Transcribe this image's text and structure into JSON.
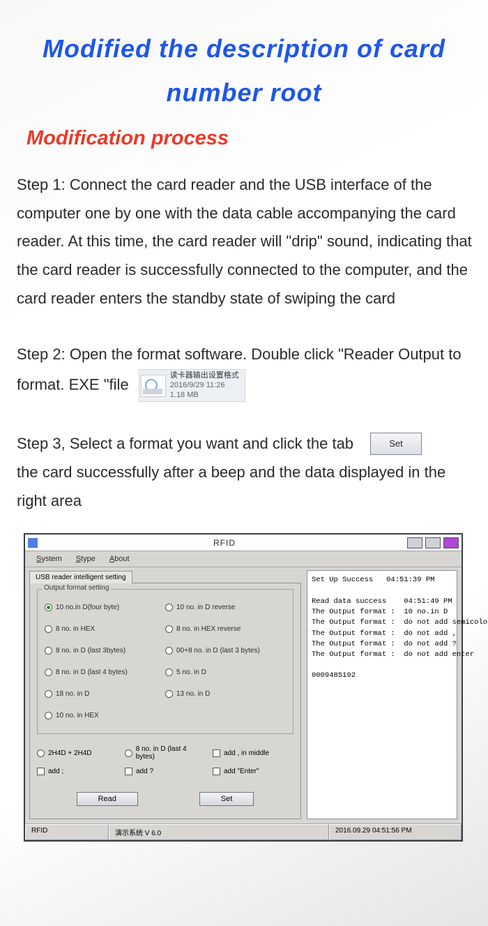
{
  "title": "Modified the description of card number root",
  "subtitle": "Modification process",
  "steps": {
    "s1": "Step 1: Connect the card reader and the USB interface of the computer one by one with the data cable accompanying the card reader. At this time, the card reader will \"drip\" sound, indicating that the card reader is successfully connected to the computer, and the card reader enters the standby state of swiping the card",
    "s2a": "Step 2: Open the format software. Double click \"Reader Output to format. EXE \"file",
    "file": {
      "name": "读卡器输出设置格式",
      "date": "2016/9/29 11:26",
      "size": "1.18 MB"
    },
    "s3a": "Step 3, Select a format you want and click the tab",
    "s3btn": "Set",
    "s3b": "the card successfully after a beep and the data displayed in the right area"
  },
  "app": {
    "window_title": "RFID",
    "menus": [
      "System",
      "Stype",
      "About"
    ],
    "tab_label": "USB reader intelligent setting",
    "group_title": "Output format setting",
    "opts": {
      "r1a": "10 no.in D(four byte)",
      "r1b": "10 no. in D reverse",
      "r2a": "8 no. in HEX",
      "r2b": "8 no. in HEX reverse",
      "r3a": "8 no. in D (last 3bytes)",
      "r3b": "00+8 no. in D (last 3 bytes)",
      "r4a": "8 no. in D (last 4 bytes)",
      "r4b": "5 no. in D",
      "r5a": "18 no. in D",
      "r5b": "13 no. in D",
      "r6a": "10 no. in HEX"
    },
    "row2": {
      "a": "2H4D + 2H4D",
      "b": "8 no. in D (last 4 bytes)",
      "c": "add , in middle"
    },
    "row3": {
      "a": "add ;",
      "b": "add ?",
      "c": "add \"Enter\""
    },
    "buttons": {
      "read": "Read",
      "set": "Set"
    },
    "log": "Set Up Success   04:51:39 PM\n\nRead data success    04:51:49 PM\nThe Output format :  10 no.in D\nThe Output format :  do not add semicolon\nThe Output format :  do not add ,\nThe Output format :  do not add ?\nThe Output format :  do not add enter\n\n0009485192",
    "status": {
      "left": "RFID",
      "mid": "演示系统  V 6.0",
      "right": "2016.09.29  04:51:56 PM"
    }
  }
}
